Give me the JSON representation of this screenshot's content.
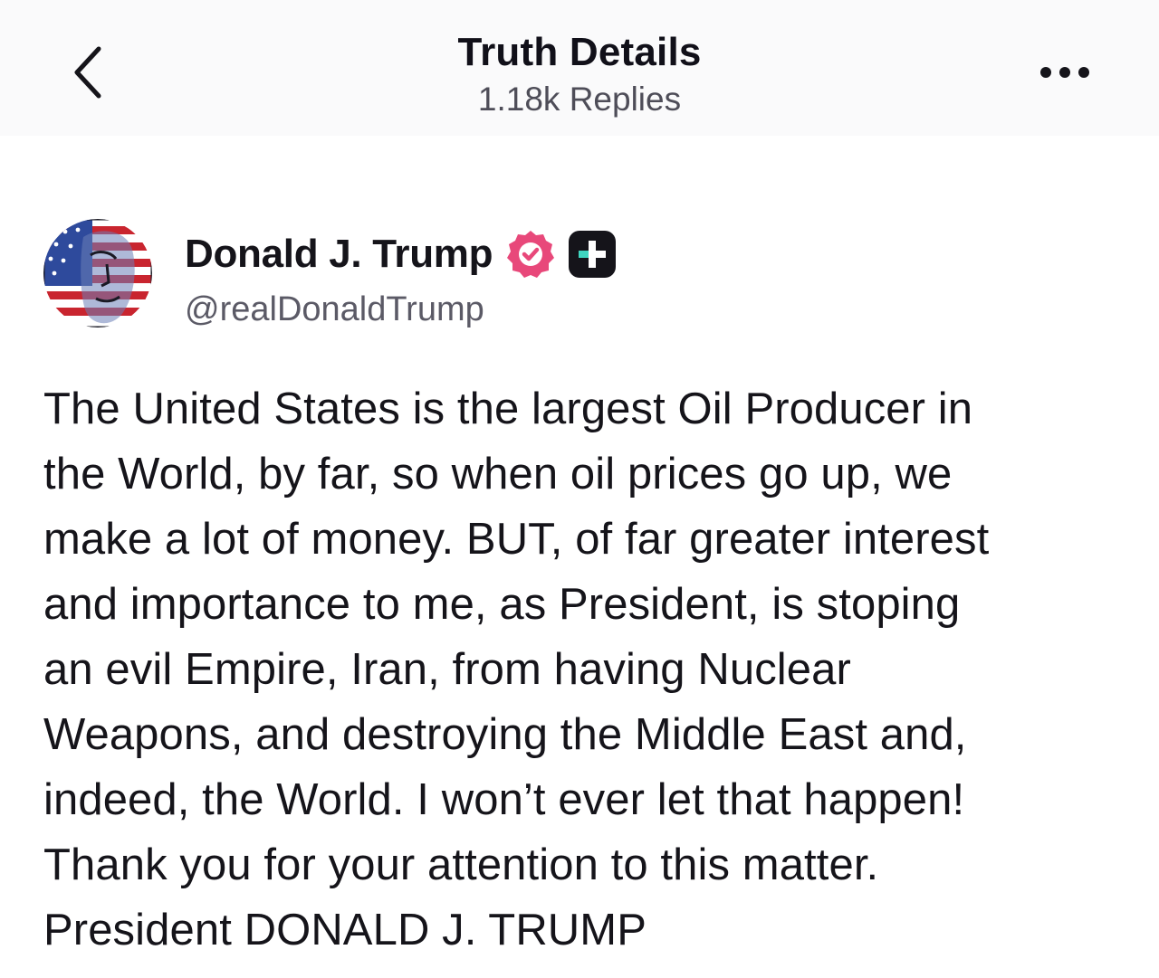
{
  "header": {
    "title": "Truth Details",
    "subtitle": "1.18k Replies",
    "back_icon": "chevron-left-icon",
    "more_icon": "ellipsis-horizontal-icon"
  },
  "author": {
    "name": "Donald J. Trump",
    "handle": "@realDonaldTrump",
    "verified_badge_color": "#e8487a",
    "plus_badge_color": "#15141a",
    "plus_badge_accent": "#3fd6c0"
  },
  "post": {
    "lines": [
      "The United States is the largest Oil Producer in",
      "the World, by far, so when oil prices go up, we",
      "make a lot of money. BUT, of far greater interest",
      "and importance to me, as President, is stoping",
      "an evil Empire, Iran, from having Nuclear",
      "Weapons, and destroying the Middle East and,",
      "indeed, the World. I won’t ever let that happen!",
      "Thank you for your attention to this matter.",
      "President DONALD J. TRUMP"
    ]
  }
}
